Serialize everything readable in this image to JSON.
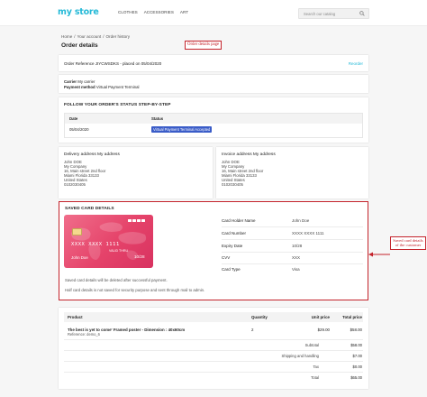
{
  "brand": {
    "name_main": "my",
    "name_dot": " ",
    "name_tail": "store",
    "color": "#24b9d7"
  },
  "nav": [
    "CLOTHES",
    "ACCESSORIES",
    "ART"
  ],
  "search": {
    "placeholder": "Search our catalog"
  },
  "breadcrumb": [
    "Home",
    "/",
    "Your account",
    "/",
    "Order history"
  ],
  "page_title": "Order details",
  "annotations": {
    "page_note": "Order details page",
    "card_note": "Saved card details of the customer"
  },
  "order": {
    "reference_line": "Order Reference JIYCWSDKS - placed on 05/04/2020",
    "reorder": "Reorder",
    "carrier_label": "Carrier",
    "carrier_value": "My carrier",
    "payment_label": "Payment method",
    "payment_value": "Virtual Payment Terminal"
  },
  "status": {
    "title": "FOLLOW YOUR ORDER'S STATUS STEP-BY-STEP",
    "col_date": "Date",
    "col_status": "Status",
    "rows": [
      {
        "date": "05/04/2020",
        "status": "Virtual Payment Terminal Accepted"
      }
    ],
    "status_color": "#3a5cc8"
  },
  "delivery": {
    "title": "Delivery address My address",
    "lines": [
      "John DOE",
      "My Company",
      "16, Main street 2nd floor",
      "Miami Florida 33133",
      "United States",
      "0102030405"
    ]
  },
  "invoice": {
    "title": "Invoice address My address",
    "lines": [
      "John DOE",
      "My Company",
      "16, Main street 2nd floor",
      "Miami Florida 33133",
      "United States",
      "0102030405"
    ]
  },
  "saved_card": {
    "title": "SAVED CARD DETAILS",
    "card_image": {
      "number": "XXXX XXXX 1111",
      "expiry_hint": "VALID THRU",
      "holder": "John Doe",
      "expiry": "10/28"
    },
    "fields": [
      {
        "label": "Card Holder Name",
        "value": "John Doe"
      },
      {
        "label": "Card Number",
        "value": "XXXX XXXX 1111"
      },
      {
        "label": "Expiry Date",
        "value": "10/28"
      },
      {
        "label": "CVV",
        "value": "XXX"
      },
      {
        "label": "Card Type",
        "value": "Visa"
      }
    ],
    "message1": "Saved card details will be deleted after successful payment.",
    "message2": "Half card details is not saved for security purpose and sent through mail to admin.",
    "card_color": "#e5436a",
    "border_color": "#c4232b"
  },
  "products": {
    "col_product": "Product",
    "col_quantity": "Quantity",
    "col_unit": "Unit price",
    "col_total": "Total price",
    "items": [
      {
        "name": "The best is yet to come' Framed poster - Dimension : 40x60cm",
        "reference": "Reference: demo_6",
        "quantity": "2",
        "unit_price": "$29.00",
        "total": "$58.00"
      }
    ],
    "summary": [
      {
        "label": "Subtotal",
        "value": "$58.00"
      },
      {
        "label": "Shipping and handling",
        "value": "$7.00"
      },
      {
        "label": "Tax",
        "value": "$0.00"
      },
      {
        "label": "Total",
        "value": "$65.00"
      }
    ]
  }
}
